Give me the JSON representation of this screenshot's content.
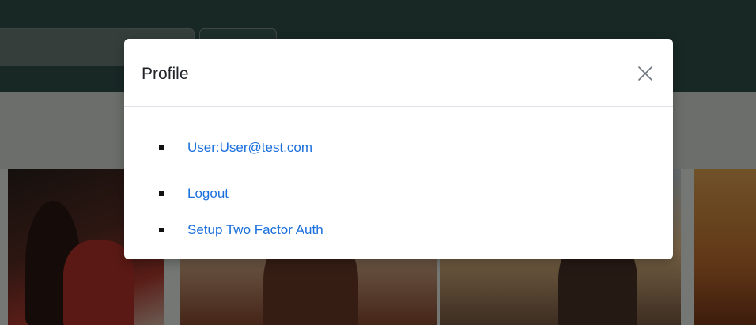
{
  "modal": {
    "title": "Profile",
    "close_icon": "close-icon",
    "items": [
      {
        "label": "User:User@test.com"
      },
      {
        "label": "Logout"
      },
      {
        "label": "Setup Two Factor Auth"
      }
    ]
  },
  "colors": {
    "link": "#1a6fdc",
    "header_bg": "#31504a",
    "overlay": "rgba(0,0,0,0.5)"
  }
}
